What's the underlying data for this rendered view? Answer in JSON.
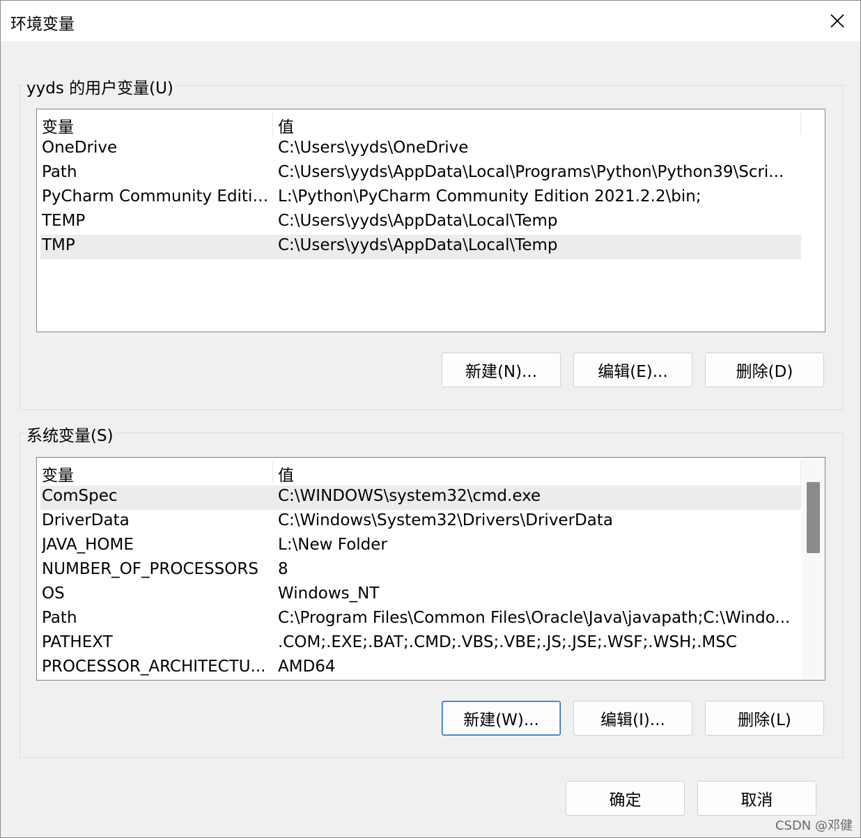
{
  "window": {
    "title": "环境变量"
  },
  "user_vars": {
    "group_title": "yyds 的用户变量(U)",
    "col_name": "变量",
    "col_value": "值",
    "rows": [
      {
        "name": "OneDrive",
        "value": "C:\\Users\\yyds\\OneDrive"
      },
      {
        "name": "Path",
        "value": "C:\\Users\\yyds\\AppData\\Local\\Programs\\Python\\Python39\\Scri..."
      },
      {
        "name": "PyCharm Community Edition",
        "value": "L:\\Python\\PyCharm Community Edition 2021.2.2\\bin;"
      },
      {
        "name": "TEMP",
        "value": "C:\\Users\\yyds\\AppData\\Local\\Temp"
      },
      {
        "name": "TMP",
        "value": "C:\\Users\\yyds\\AppData\\Local\\Temp"
      }
    ],
    "selected_row": "TMP",
    "buttons": {
      "new": "新建(N)...",
      "edit": "编辑(E)...",
      "delete": "删除(D)"
    }
  },
  "system_vars": {
    "group_title": "系统变量(S)",
    "col_name": "变量",
    "col_value": "值",
    "rows": [
      {
        "name": "ComSpec",
        "value": "C:\\WINDOWS\\system32\\cmd.exe"
      },
      {
        "name": "DriverData",
        "value": "C:\\Windows\\System32\\Drivers\\DriverData"
      },
      {
        "name": "JAVA_HOME",
        "value": "L:\\New Folder"
      },
      {
        "name": "NUMBER_OF_PROCESSORS",
        "value": "8"
      },
      {
        "name": "OS",
        "value": "Windows_NT"
      },
      {
        "name": "Path",
        "value": "C:\\Program Files\\Common Files\\Oracle\\Java\\javapath;C:\\Windo..."
      },
      {
        "name": "PATHEXT",
        "value": ".COM;.EXE;.BAT;.CMD;.VBS;.VBE;.JS;.JSE;.WSF;.WSH;.MSC"
      },
      {
        "name": "PROCESSOR_ARCHITECTU...",
        "value": "AMD64"
      }
    ],
    "selected_row": "ComSpec",
    "buttons": {
      "new": "新建(W)...",
      "edit": "编辑(I)...",
      "delete": "删除(L)"
    }
  },
  "footer": {
    "ok": "确定",
    "cancel": "取消"
  },
  "watermark": "CSDN @邓健"
}
